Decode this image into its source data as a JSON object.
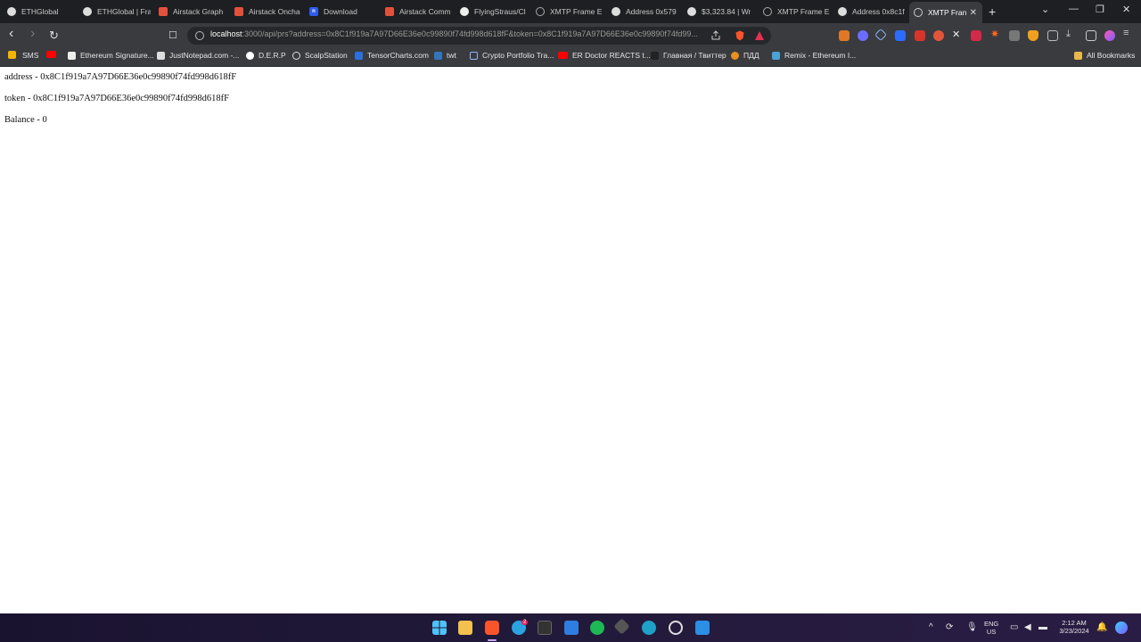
{
  "browser": {
    "tabs": [
      {
        "label": "ETHGlobal",
        "active": false,
        "favicon": "ethglobal-icon"
      },
      {
        "label": "ETHGlobal | Fra",
        "active": false,
        "favicon": "ethglobal-icon"
      },
      {
        "label": "Airstack Graph",
        "active": false,
        "favicon": "airstack-icon"
      },
      {
        "label": "Airstack Oncha",
        "active": false,
        "favicon": "airstack-icon"
      },
      {
        "label": "Download",
        "active": false,
        "favicon": "n-icon"
      },
      {
        "label": "Airstack Comm",
        "active": false,
        "favicon": "airstack-icon"
      },
      {
        "label": "FlyingStraus/Cl",
        "active": false,
        "favicon": "github-icon"
      },
      {
        "label": "XMTP Frame E",
        "active": false,
        "favicon": "globe-icon"
      },
      {
        "label": "Address 0x579",
        "active": false,
        "favicon": "etherscan-icon"
      },
      {
        "label": "$3,323.84 | Wr",
        "active": false,
        "favicon": "etherscan-icon"
      },
      {
        "label": "XMTP Frame E",
        "active": false,
        "favicon": "globe-icon"
      },
      {
        "label": "Address 0x8c1f",
        "active": false,
        "favicon": "etherscan-icon"
      },
      {
        "label": "XMTP Fran",
        "active": true,
        "favicon": "globe-icon"
      }
    ],
    "new_tab": "+",
    "window": {
      "minimize": "—",
      "restore": "❐",
      "close": "✕",
      "tab_search": "⌄"
    },
    "nav": {
      "back": "‹",
      "forward": "›",
      "reload": "↻",
      "bookmark": "☐"
    },
    "url_host": "localhost",
    "url_rest": ":3000/api/prs?address=0x8C1f919a7A97D66E36e0c99890f74fd998d618fF&token=0x8C1f919a7A97D66E36e0c99890f74fd99...",
    "bookmarks": [
      {
        "label": "",
        "icon": "apps-grid-icon"
      },
      {
        "label": "SMS",
        "icon": "sms-icon"
      },
      {
        "label": "",
        "icon": "youtube-icon"
      },
      {
        "label": "Ethereum Signature...",
        "icon": "ethereum-icon"
      },
      {
        "label": "JustNotepad.com -...",
        "icon": "notepad-icon"
      },
      {
        "label": "D.E.R.P",
        "icon": "derp-icon"
      },
      {
        "label": "ScalpStation",
        "icon": "scalpstation-icon"
      },
      {
        "label": "TensorCharts.com",
        "icon": "tensorcharts-icon"
      },
      {
        "label": "twt",
        "icon": "twt-icon"
      },
      {
        "label": "Crypto Portfolio Tra...",
        "icon": "crypto-portfolio-icon"
      },
      {
        "label": "ER Doctor REACTS t...",
        "icon": "youtube-icon"
      },
      {
        "label": "Главная / Твиттер",
        "icon": "twitter-icon"
      },
      {
        "label": "ПДД",
        "icon": "pdd-icon"
      },
      {
        "label": "Remix - Ethereum I...",
        "icon": "remix-icon"
      },
      {
        "label": "All Bookmarks",
        "icon": "folder-icon"
      }
    ]
  },
  "page": {
    "address_line": "address - 0x8C1f919a7A97D66E36e0c99890f74fd998d618fF",
    "token_line": "token - 0x8C1f919a7A97D66E36e0c99890f74fd998d618fF",
    "balance_line": "Balance - 0"
  },
  "taskbar": {
    "lang": "ENG",
    "region": "US",
    "time": "2:12 AM",
    "date": "3/23/2024",
    "telegram_badge": "2"
  },
  "colors": {
    "titlebar": "#1e1f22",
    "toolbar": "#3a3b3f",
    "omnibox": "#26272a",
    "page_bg": "#ffffff",
    "taskbar": "#1a1330"
  }
}
